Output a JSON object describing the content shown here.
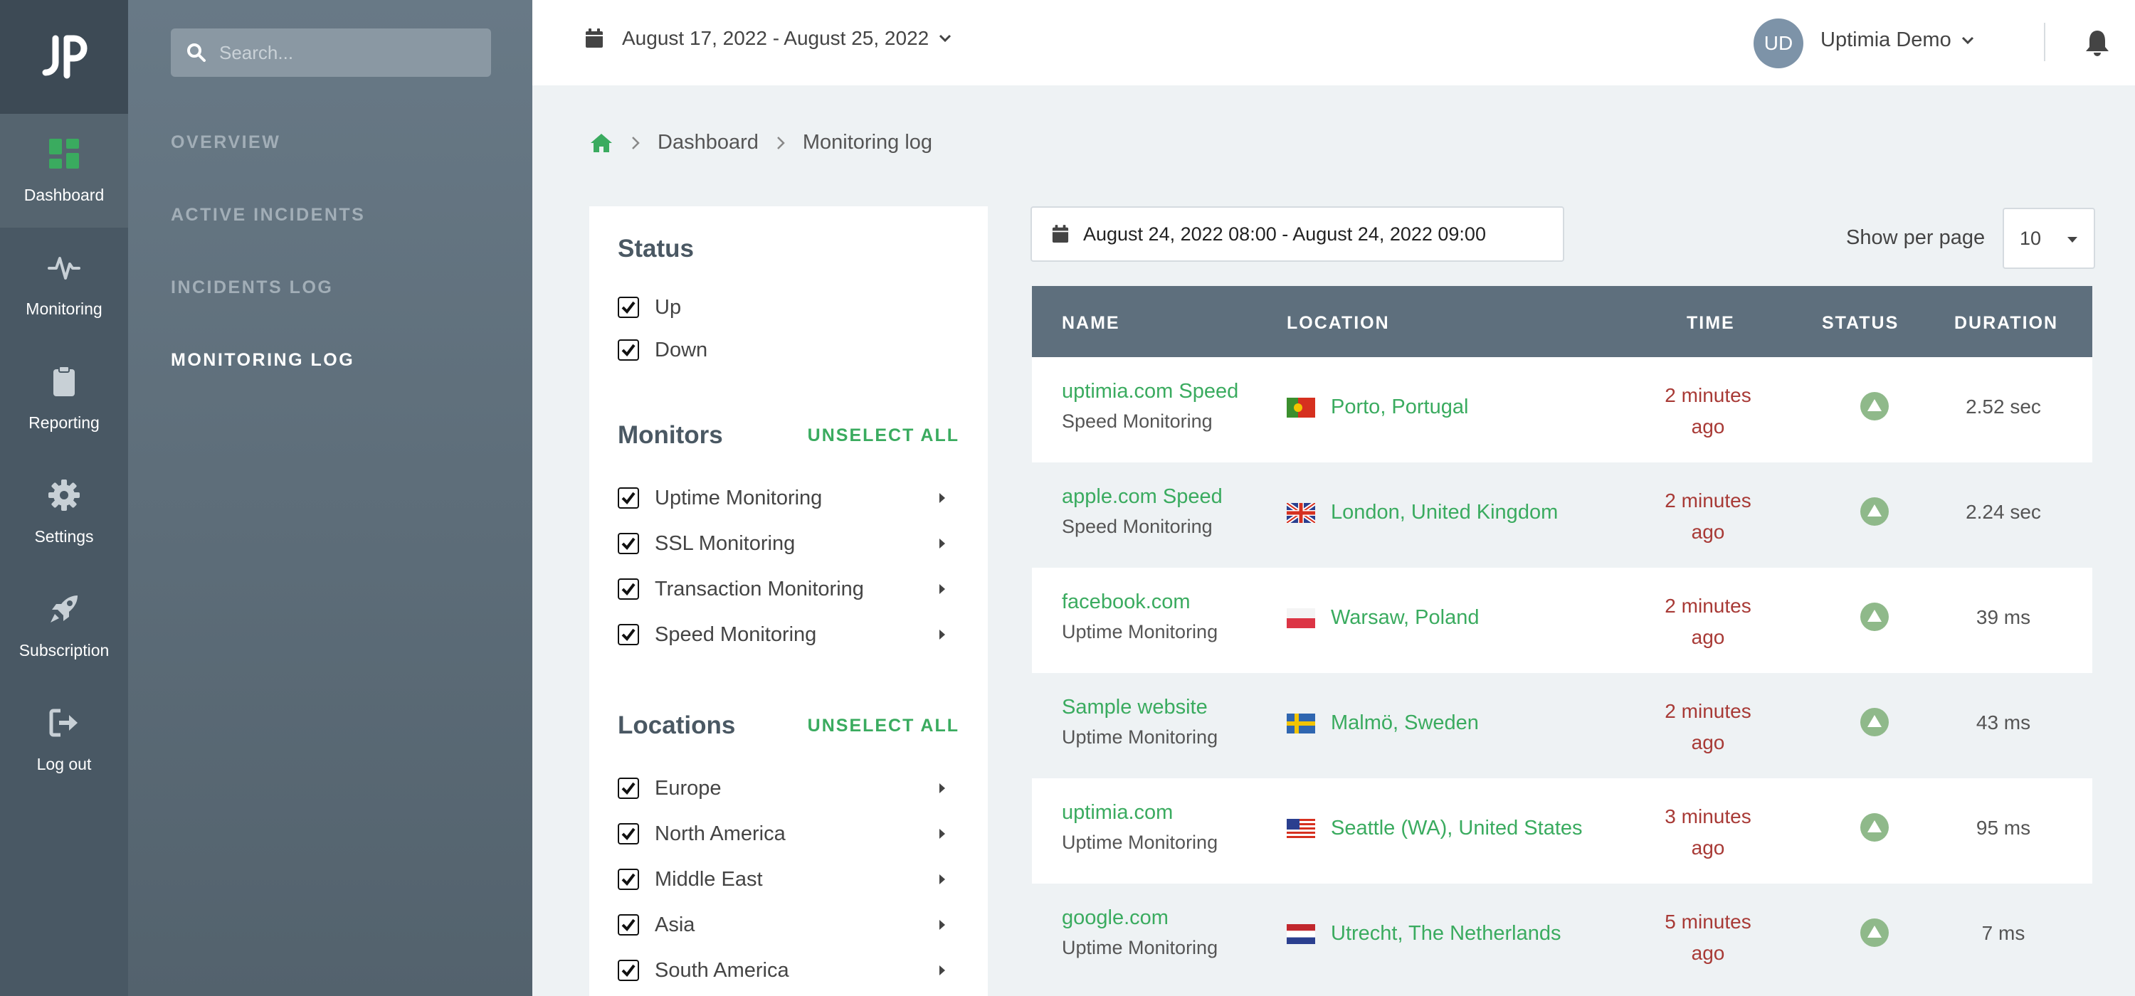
{
  "rail": {
    "items": [
      {
        "label": "Dashboard"
      },
      {
        "label": "Monitoring"
      },
      {
        "label": "Reporting"
      },
      {
        "label": "Settings"
      },
      {
        "label": "Subscription"
      },
      {
        "label": "Log out"
      }
    ]
  },
  "subnav": {
    "search_placeholder": "Search...",
    "items": [
      {
        "label": "OVERVIEW"
      },
      {
        "label": "ACTIVE INCIDENTS"
      },
      {
        "label": "INCIDENTS LOG"
      },
      {
        "label": "MONITORING LOG"
      }
    ]
  },
  "header": {
    "date_range": "August 17, 2022 - August 25, 2022",
    "avatar_initials": "UD",
    "user_name": "Uptimia Demo"
  },
  "breadcrumb": {
    "parent": "Dashboard",
    "current": "Monitoring log"
  },
  "filters": {
    "status_title": "Status",
    "status_options": [
      "Up",
      "Down"
    ],
    "monitors_title": "Monitors",
    "monitors_unselect": "UNSELECT ALL",
    "monitor_options": [
      "Uptime Monitoring",
      "SSL Monitoring",
      "Transaction Monitoring",
      "Speed Monitoring"
    ],
    "locations_title": "Locations",
    "locations_unselect": "UNSELECT ALL",
    "location_options": [
      "Europe",
      "North America",
      "Middle East",
      "Asia",
      "South America"
    ]
  },
  "controls": {
    "time_range": "August 24, 2022 08:00 - August 24, 2022 09:00",
    "per_page_label": "Show per page",
    "per_page_value": "10"
  },
  "table": {
    "headers": {
      "name": "NAME",
      "location": "LOCATION",
      "time": "TIME",
      "status": "STATUS",
      "duration": "DURATION"
    },
    "rows": [
      {
        "name": "uptimia.com Speed",
        "type": "Speed Monitoring",
        "location": "Porto, Portugal",
        "flag": "portugal-flag-icon",
        "time_1": "2 minutes",
        "time_2": "ago",
        "duration": "2.52 sec"
      },
      {
        "name": "apple.com Speed",
        "type": "Speed Monitoring",
        "location": "London, United Kingdom",
        "flag": "uk-flag-icon",
        "time_1": "2 minutes",
        "time_2": "ago",
        "duration": "2.24 sec"
      },
      {
        "name": "facebook.com",
        "type": "Uptime Monitoring",
        "location": "Warsaw, Poland",
        "flag": "poland-flag-icon",
        "time_1": "2 minutes",
        "time_2": "ago",
        "duration": "39 ms"
      },
      {
        "name": "Sample website",
        "type": "Uptime Monitoring",
        "location": "Malmö, Sweden",
        "flag": "sweden-flag-icon",
        "time_1": "2 minutes",
        "time_2": "ago",
        "duration": "43 ms"
      },
      {
        "name": "uptimia.com",
        "type": "Uptime Monitoring",
        "location": "Seattle (WA), United States",
        "flag": "usa-flag-icon",
        "time_1": "3 minutes",
        "time_2": "ago",
        "duration": "95 ms"
      },
      {
        "name": "google.com",
        "type": "Uptime Monitoring",
        "location": "Utrecht, The Netherlands",
        "flag": "netherlands-flag-icon",
        "time_1": "5 minutes",
        "time_2": "ago",
        "duration": "7 ms"
      }
    ]
  },
  "colors": {
    "accent_green": "#3aab5f",
    "time_red": "#a83a36",
    "status_up": "#8fb98a",
    "table_header": "#5e6f7d"
  }
}
